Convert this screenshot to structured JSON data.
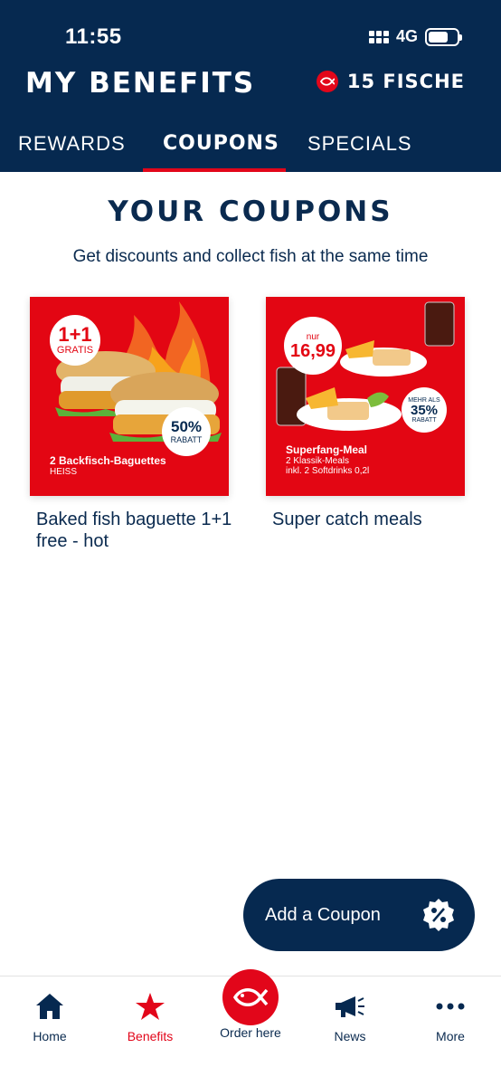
{
  "status": {
    "time": "11:55",
    "network": "4G"
  },
  "header": {
    "title": "MY BENEFITS",
    "fish_count": "15 FISCHE"
  },
  "tabs": [
    {
      "label": "REWARDS",
      "active": false
    },
    {
      "label": "COUPONS",
      "active": true
    },
    {
      "label": "SPECIALS",
      "active": false
    }
  ],
  "main": {
    "title": "YOUR COUPONS",
    "subtitle": "Get discounts and collect fish at the same time"
  },
  "coupons": [
    {
      "label": "Baked fish baguette 1+1 free - hot",
      "image": {
        "badge_big": "1+1",
        "badge_small": "GRATIS",
        "discount": "50%",
        "discount_label": "RABATT",
        "product_title": "2 Backfisch-Baguettes",
        "product_sub": "HEISS"
      }
    },
    {
      "label": "Super catch meals",
      "image": {
        "price_prefix": "nur",
        "price": "16,99",
        "discount_prefix": "MEHR ALS",
        "discount": "35%",
        "discount_label": "RABATT",
        "product_title": "Superfang-Meal",
        "product_sub1": "2 Klassik-Meals",
        "product_sub2": "inkl. 2 Softdrinks 0,2l"
      }
    }
  ],
  "add_coupon": {
    "label": "Add a Coupon",
    "icon": "percent-badge-icon"
  },
  "bottom_nav": [
    {
      "label": "Home",
      "icon": "home-icon"
    },
    {
      "label": "Benefits",
      "icon": "star-icon",
      "active": true
    },
    {
      "label": "Order here",
      "icon": "fish-logo-icon"
    },
    {
      "label": "News",
      "icon": "megaphone-icon"
    },
    {
      "label": "More",
      "icon": "more-dots-icon"
    }
  ],
  "colors": {
    "navy": "#062950",
    "red": "#e2061a",
    "coupon_bg": "#e30613"
  }
}
